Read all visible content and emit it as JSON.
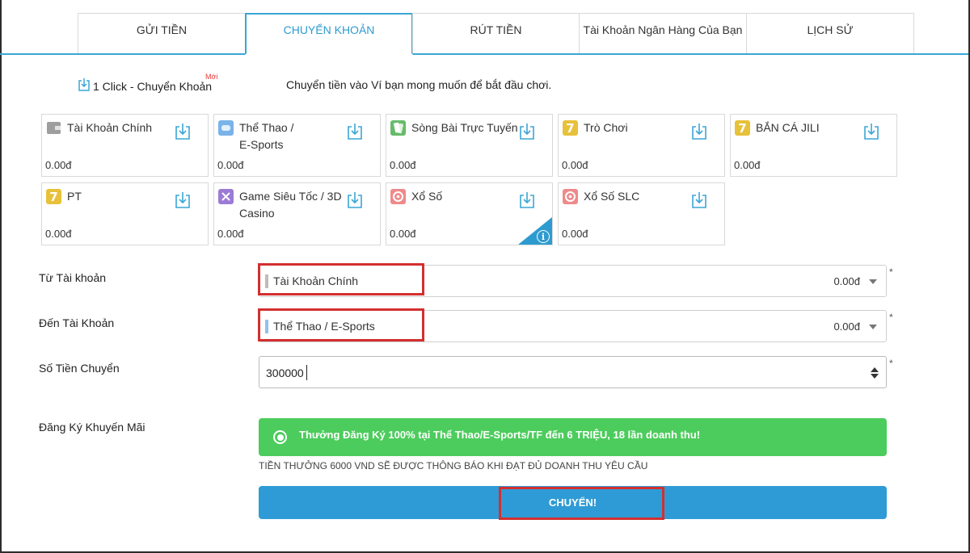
{
  "tabs": [
    {
      "label": "GỬI TIỀN",
      "active": false
    },
    {
      "label": "CHUYỂN KHOẢN",
      "active": true
    },
    {
      "label": "RÚT TIỀN",
      "active": false
    },
    {
      "label": "Tài Khoản Ngân Hàng Của Bạn",
      "active": false
    },
    {
      "label": "LỊCH SỬ",
      "active": false
    }
  ],
  "intro": {
    "one_click_label": "1 Click - Chuyển Khoản",
    "new_badge": "Mới",
    "description": "Chuyển tiền vào Ví bạn mong muốn để bắt đầu chơi."
  },
  "wallets": [
    {
      "name": "Tài Khoản Chính",
      "amount": "0.00đ",
      "icon": "wallet-icon",
      "color": "#9e9e9e"
    },
    {
      "name": "Thể Thao /\nE-Sports",
      "amount": "0.00đ",
      "icon": "sports-icon",
      "color": "#7ab3e8"
    },
    {
      "name": "Sòng Bài Trực Tuyến",
      "amount": "0.00đ",
      "icon": "cards-icon",
      "color": "#66bb6a"
    },
    {
      "name": "Trò Chơi",
      "amount": "0.00đ",
      "icon": "slot-seven-icon",
      "color": "#e8c13a"
    },
    {
      "name": "BẮN CÁ JILI",
      "amount": "0.00đ",
      "icon": "slot-seven-icon",
      "color": "#e8c13a"
    },
    {
      "name": "PT",
      "amount": "0.00đ",
      "icon": "slot-seven-icon",
      "color": "#e8c13a"
    },
    {
      "name": "Game Siêu Tốc / 3D\nCasino",
      "amount": "0.00đ",
      "icon": "game-icon",
      "color": "#9c7bd6"
    },
    {
      "name": "Xổ Số",
      "amount": "0.00đ",
      "icon": "lottery-icon",
      "color": "#ef8a8a",
      "info_corner": true
    },
    {
      "name": "Xổ Số SLC",
      "amount": "0.00đ",
      "icon": "lottery-icon",
      "color": "#ef8a8a"
    }
  ],
  "form": {
    "from_label": "Từ Tài khoản",
    "from_value": "Tài Khoản Chính",
    "from_amount": "0.00đ",
    "to_label": "Đến Tài Khoản",
    "to_value": "Thể Thao / E-Sports",
    "to_amount": "0.00đ",
    "amount_label": "Số Tiền Chuyển",
    "amount_value": "300000",
    "required_mark": "*",
    "promo_label": "Đăng Ký Khuyến Mãi",
    "promo_text": "Thưởng Đăng Ký 100% tại Thể Thao/E-Sports/TF đến 6 TRIỆU, 18 lần doanh thu!",
    "promo_note": "TIỀN THƯỞNG 6000 VND SẼ ĐƯỢC THÔNG BÁO KHI ĐẠT ĐỦ DOANH THU YÊU CẦU",
    "submit_label": "CHUYỂN!"
  },
  "colors": {
    "accent": "#2f9bd6",
    "promo_green": "#4ccc5c",
    "highlight_red": "#d32f2f"
  }
}
